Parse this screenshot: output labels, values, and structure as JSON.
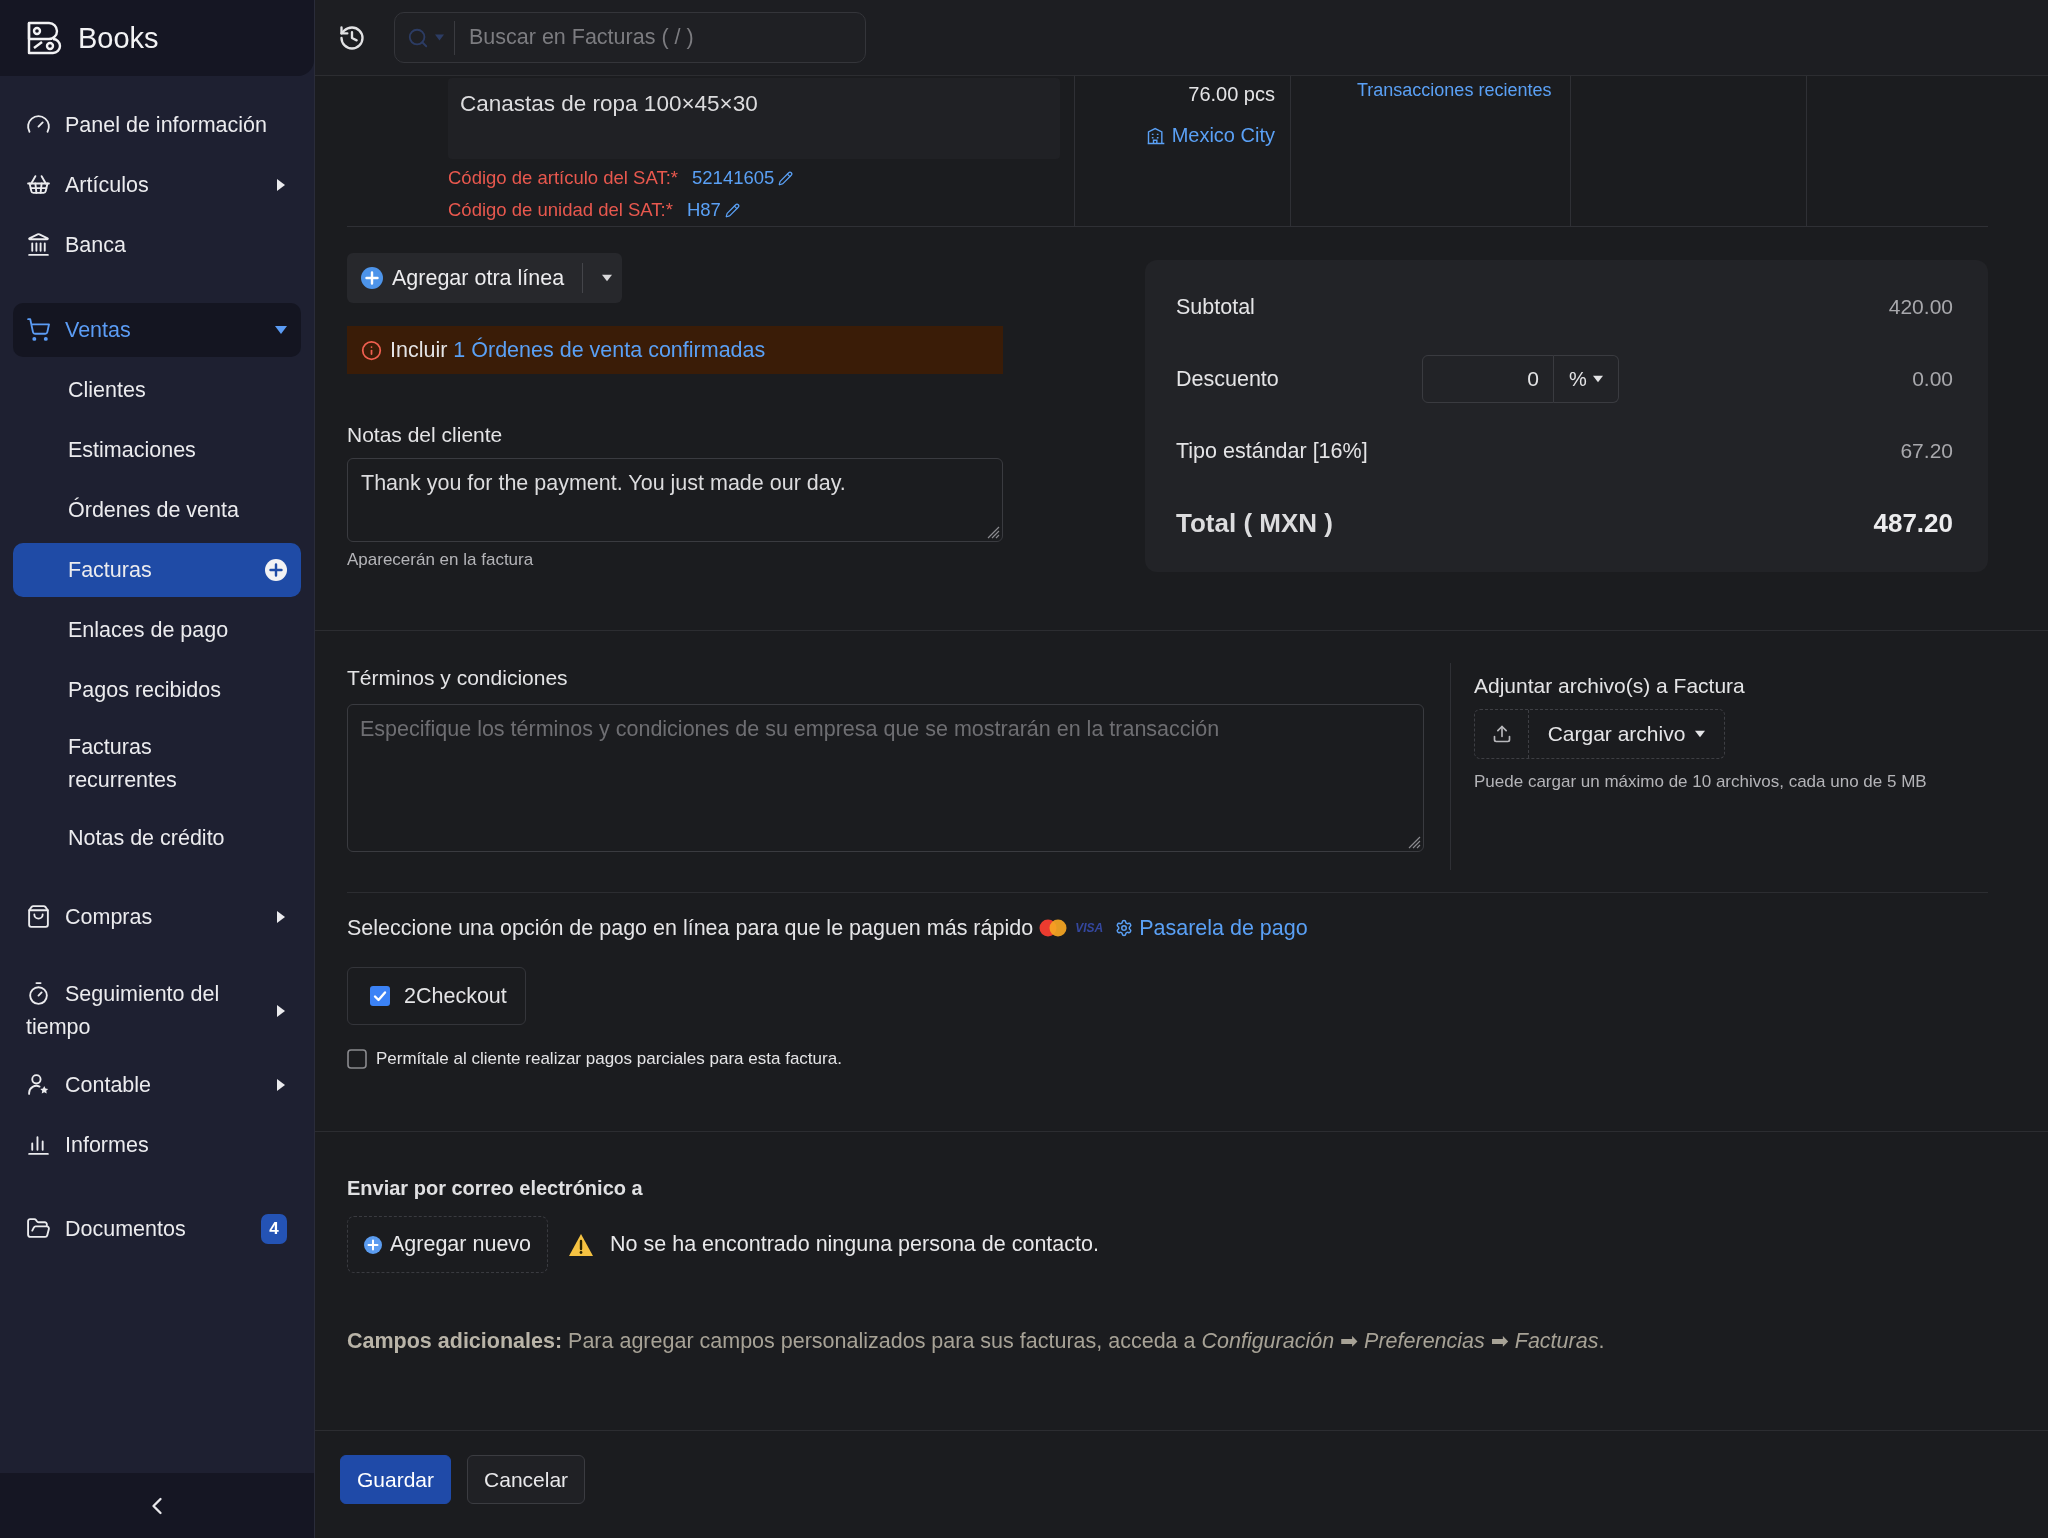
{
  "sidebar": {
    "app_name": "Books",
    "items": [
      {
        "kind": "link",
        "label": "Panel de información",
        "selected": false
      },
      {
        "kind": "group",
        "label": "Artículos",
        "selected": false,
        "expanded": false
      },
      {
        "kind": "link",
        "label": "Banca",
        "selected": false
      },
      {
        "kind": "group",
        "label": "Ventas",
        "selected": true,
        "expanded": true,
        "children": [
          {
            "label": "Clientes",
            "selected": false
          },
          {
            "label": "Estimaciones",
            "selected": false
          },
          {
            "label": "Órdenes de venta",
            "selected": false
          },
          {
            "label": "Facturas",
            "selected": true
          },
          {
            "label": "Enlaces de pago",
            "selected": false
          },
          {
            "label": "Pagos recibidos",
            "selected": false
          },
          {
            "label": "Facturas recurrentes",
            "selected": false
          },
          {
            "label": "Notas de crédito",
            "selected": false
          }
        ]
      },
      {
        "kind": "group",
        "label": "Compras",
        "selected": false,
        "expanded": false
      },
      {
        "kind": "group",
        "label": "Seguimiento del tiempo",
        "selected": false,
        "expanded": false
      },
      {
        "kind": "group",
        "label": "Contable",
        "selected": false,
        "expanded": false
      },
      {
        "kind": "link",
        "label": "Informes",
        "selected": false
      },
      {
        "kind": "link",
        "label": "Documentos",
        "selected": false,
        "badge": "4"
      }
    ]
  },
  "top_bar": {
    "search": {
      "placeholder": "Buscar en Facturas ( / )"
    }
  },
  "line_item": {
    "description": "Canastas de ropa 100×45×30",
    "sat_codes": [
      {
        "label": "Código de artículo del SAT:*",
        "value": "52141605"
      },
      {
        "label": "Código de unidad del SAT:*",
        "value": "H87"
      }
    ],
    "quantity": "76.00 pcs",
    "location": "Mexico City",
    "recent_transactions_link": "Transacciones recientes"
  },
  "add_line_button": "Agregar otra línea",
  "sales_order_alert": {
    "prefix": "Incluir",
    "link": "1 Órdenes de venta confirmadas"
  },
  "customer_notes": {
    "label": "Notas del cliente",
    "value": "Thank you for the payment. You just made our day.",
    "hint": "Aparecerán en la factura"
  },
  "totals": {
    "rows": [
      {
        "kind": "amount",
        "label": "Subtotal",
        "value": "420.00"
      },
      {
        "kind": "discount",
        "label": "Descuento",
        "input": "0",
        "unit": "%",
        "value": "0.00"
      },
      {
        "kind": "amount",
        "label": "Tipo estándar [16%]",
        "value": "67.20"
      },
      {
        "kind": "total",
        "label": "Total ( MXN )",
        "value": "487.20"
      }
    ]
  },
  "terms": {
    "label": "Términos y condiciones",
    "placeholder": "Especifique los términos y condiciones de su empresa que se mostrarán en la transacción"
  },
  "attachments": {
    "label": "Adjuntar archivo(s) a Factura",
    "button": "Cargar archivo",
    "hint": "Puede cargar un máximo de 10 archivos, cada uno de 5 MB"
  },
  "payment": {
    "prompt": "Seleccione una opción de pago en línea para que le paguen más rápido",
    "card_logo_text": "VISA",
    "gateway_link": "Pasarela de pago",
    "gateways": [
      {
        "label": "2Checkout",
        "checked": true
      }
    ],
    "partial_payments": {
      "label": "Permítale al cliente realizar pagos parciales para esta factura.",
      "checked": false
    }
  },
  "email": {
    "label": "Enviar por correo electrónico a",
    "add_button": "Agregar nuevo",
    "warning": "No se ha encontrado ninguna persona de contacto."
  },
  "additional_fields_note": "**Campos adicionales:** Para agregar campos personalizados para sus facturas, acceda a *Configuración* ➡ *Preferencias* ➡ *Facturas*.",
  "footer": {
    "buttons": [
      {
        "kind": "primary",
        "label": "Guardar"
      },
      {
        "kind": "secondary",
        "label": "Cancelar"
      }
    ]
  }
}
